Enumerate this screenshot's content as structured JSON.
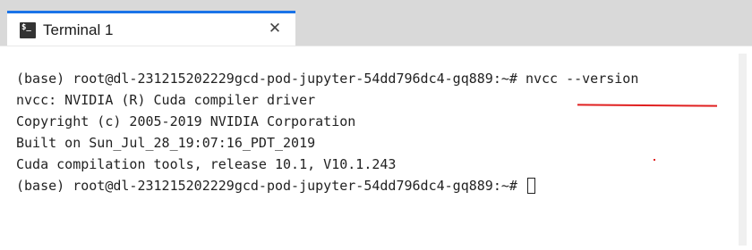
{
  "tab": {
    "icon": "terminal-icon",
    "icon_text": "$_",
    "title": "Terminal 1",
    "close": "✕"
  },
  "terminal": {
    "lines": [
      "(base) root@dl-231215202229gcd-pod-jupyter-54dd796dc4-gq889:~# nvcc --version",
      "nvcc: NVIDIA (R) Cuda compiler driver",
      "Copyright (c) 2005-2019 NVIDIA Corporation",
      "Built on Sun_Jul_28_19:07:16_PDT_2019",
      "Cuda compilation tools, release 10.1, V10.1.243",
      "(base) root@dl-231215202229gcd-pod-jupyter-54dd796dc4-gq889:~# "
    ]
  },
  "colors": {
    "accent": "#1a73e8",
    "annotation": "#e02020"
  }
}
